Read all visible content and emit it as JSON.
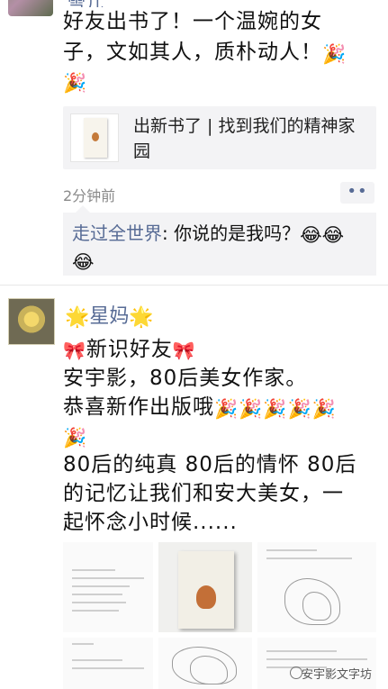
{
  "post1": {
    "nickname": "雪儿",
    "text_line1": "好友出书了！一个温婉的女",
    "text_line2": "子，文如其人，质朴动人！",
    "emoji_icon": "party-popper-icon",
    "link": {
      "title_line1": "出新书了 | 找到我们的精神家",
      "title_line2": "园"
    },
    "time": "2分钟前",
    "more": "••",
    "comment": {
      "author": "走过全世界",
      "text": ": 你说的是我吗？"
    }
  },
  "post2": {
    "nickname": "星妈",
    "line1": "新识好友",
    "line2": "安宇影，80后美女作家。",
    "line3": "恭喜新作出版哦",
    "line4": "80后的纯真 80后的情怀 80后",
    "line5": "的记忆让我们和安大美女，一",
    "line6": "起怀念小时候......"
  },
  "watermark": "安宇影文字坊",
  "emoji": {
    "party": "🎉",
    "laugh": "😂",
    "star": "🌟",
    "bow": "🎀"
  }
}
